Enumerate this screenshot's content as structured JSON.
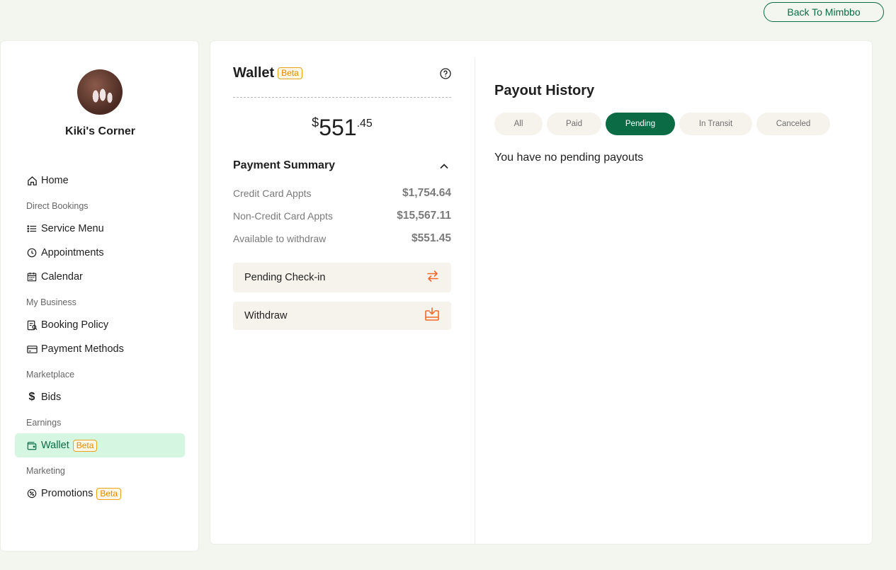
{
  "header": {
    "back_label": "Back To Mimbbo"
  },
  "sidebar": {
    "business_name": "Kiki's Corner",
    "home_label": "Home",
    "sections": {
      "direct_bookings": "Direct Bookings",
      "my_business": "My Business",
      "marketplace": "Marketplace",
      "earnings": "Earnings",
      "marketing": "Marketing"
    },
    "items": {
      "service_menu": "Service Menu",
      "appointments": "Appointments",
      "calendar": "Calendar",
      "booking_policy": "Booking Policy",
      "payment_methods": "Payment Methods",
      "bids": "Bids",
      "wallet": "Wallet",
      "promotions": "Promotions"
    },
    "beta_label": "Beta"
  },
  "wallet": {
    "title": "Wallet",
    "badge": "Beta",
    "balance": {
      "currency": "$",
      "whole": "551",
      "cents": ".45"
    },
    "summary_title": "Payment Summary",
    "rows": [
      {
        "label": "Credit Card Appts",
        "value": "$1,754.64"
      },
      {
        "label": "Non-Credit Card Appts",
        "value": "$15,567.11"
      },
      {
        "label": "Available to withdraw",
        "value": "$551.45"
      }
    ],
    "pending_checkin_label": "Pending Check-in",
    "withdraw_label": "Withdraw"
  },
  "payout": {
    "title": "Payout History",
    "tabs": [
      "All",
      "Paid",
      "Pending",
      "In Transit",
      "Canceled"
    ],
    "active_tab": "Pending",
    "empty_message": "You have no pending payouts"
  },
  "colors": {
    "brand_green": "#0b6b45",
    "active_nav_bg": "#d5f7e2",
    "accent_orange": "#f06a2a",
    "beta_orange": "#e9a21b",
    "page_bg": "#f3f5ef"
  }
}
